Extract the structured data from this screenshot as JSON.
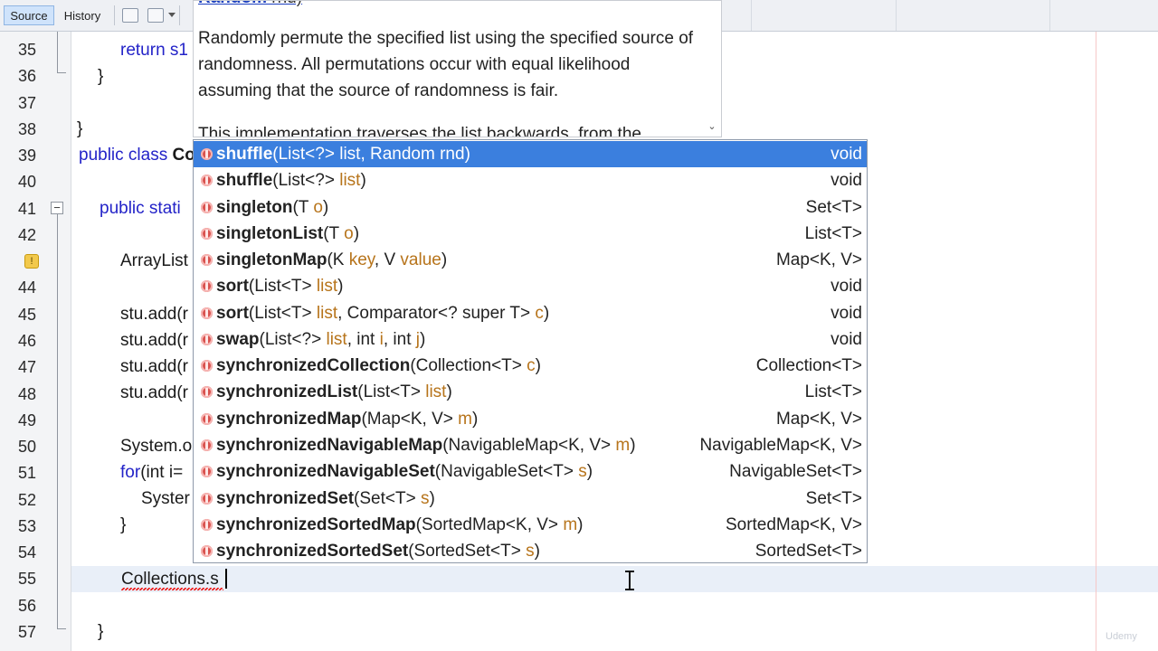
{
  "toolbar": {
    "tabs": [
      {
        "label": "Source",
        "active": true
      },
      {
        "label": "History",
        "active": false
      }
    ],
    "icons": [
      "back-history-icon",
      "forward-history-icon",
      "dropdown-icon"
    ]
  },
  "editor": {
    "line_numbers": [
      "35",
      "36",
      "37",
      "38",
      "39",
      "40",
      "41",
      "42",
      "",
      "44",
      "45",
      "46",
      "47",
      "48",
      "49",
      "50",
      "51",
      "52",
      "53",
      "54",
      "55",
      "56",
      "57"
    ],
    "code": {
      "l35": "return s1",
      "l36": "}",
      "l38": "}",
      "l39_kw": "public class ",
      "l39_name": "Co",
      "l41_kw": "public stati",
      "l43": "ArrayList",
      "l45": "stu.add(r",
      "l46": "stu.add(r",
      "l47": "stu.add(r",
      "l48": "stu.add(r",
      "l50": "System.o",
      "l51_kw": "for",
      "l51_rest": "(int i=",
      "l52": "Syster",
      "l53": "}",
      "l55": "Collections.s",
      "l57": "}"
    },
    "accent": "#3b7fde",
    "keyword_color": "#2323c8"
  },
  "javadoc": {
    "signature_name": "Random",
    "signature_rest": " rnd)",
    "body": "Randomly permute the specified list using the specified source of randomness. All permutations occur with equal likelihood assuming that the source of randomness is fair.",
    "more": "This implementation traverses the list backwards, from the"
  },
  "completion": {
    "items": [
      {
        "name": "shuffle",
        "pre": "(List<?> ",
        "params": [
          {
            "t": "",
            "n": "list"
          },
          {
            "t": ", Random ",
            "n": "rnd"
          }
        ],
        "post": ")",
        "ret": "void",
        "selected": true
      },
      {
        "name": "shuffle",
        "pre": "(List<?> ",
        "params": [
          {
            "t": "",
            "n": "list"
          }
        ],
        "post": ")",
        "ret": "void"
      },
      {
        "name": "singleton",
        "pre": "(T ",
        "params": [
          {
            "t": "",
            "n": "o"
          }
        ],
        "post": ")",
        "ret": "Set<T>"
      },
      {
        "name": "singletonList",
        "pre": "(T ",
        "params": [
          {
            "t": "",
            "n": "o"
          }
        ],
        "post": ")",
        "ret": "List<T>"
      },
      {
        "name": "singletonMap",
        "pre": "(K ",
        "params": [
          {
            "t": "",
            "n": "key"
          },
          {
            "t": ", V ",
            "n": "value"
          }
        ],
        "post": ")",
        "ret": "Map<K, V>"
      },
      {
        "name": "sort",
        "pre": "(List<T> ",
        "params": [
          {
            "t": "",
            "n": "list"
          }
        ],
        "post": ")",
        "ret": "void"
      },
      {
        "name": "sort",
        "pre": "(List<T> ",
        "params": [
          {
            "t": "",
            "n": "list"
          },
          {
            "t": ", Comparator<? super T> ",
            "n": "c"
          }
        ],
        "post": ")",
        "ret": "void"
      },
      {
        "name": "swap",
        "pre": "(List<?> ",
        "params": [
          {
            "t": "",
            "n": "list"
          },
          {
            "t": ", int ",
            "n": "i"
          },
          {
            "t": ", int ",
            "n": "j"
          }
        ],
        "post": ")",
        "ret": "void"
      },
      {
        "name": "synchronizedCollection",
        "pre": "(Collection<T> ",
        "params": [
          {
            "t": "",
            "n": "c"
          }
        ],
        "post": ")",
        "ret": "Collection<T>"
      },
      {
        "name": "synchronizedList",
        "pre": "(List<T> ",
        "params": [
          {
            "t": "",
            "n": "list"
          }
        ],
        "post": ")",
        "ret": "List<T>"
      },
      {
        "name": "synchronizedMap",
        "pre": "(Map<K, V> ",
        "params": [
          {
            "t": "",
            "n": "m"
          }
        ],
        "post": ")",
        "ret": "Map<K, V>"
      },
      {
        "name": "synchronizedNavigableMap",
        "pre": "(NavigableMap<K, V> ",
        "params": [
          {
            "t": "",
            "n": "m"
          }
        ],
        "post": ")",
        "ret": "NavigableMap<K, V>"
      },
      {
        "name": "synchronizedNavigableSet",
        "pre": "(NavigableSet<T> ",
        "params": [
          {
            "t": "",
            "n": "s"
          }
        ],
        "post": ")",
        "ret": "NavigableSet<T>"
      },
      {
        "name": "synchronizedSet",
        "pre": "(Set<T> ",
        "params": [
          {
            "t": "",
            "n": "s"
          }
        ],
        "post": ")",
        "ret": "Set<T>"
      },
      {
        "name": "synchronizedSortedMap",
        "pre": "(SortedMap<K, V> ",
        "params": [
          {
            "t": "",
            "n": "m"
          }
        ],
        "post": ")",
        "ret": "SortedMap<K, V>"
      },
      {
        "name": "synchronizedSortedSet",
        "pre": "(SortedSet<T> ",
        "params": [
          {
            "t": "",
            "n": "s"
          }
        ],
        "post": ")",
        "ret": "SortedSet<T>"
      }
    ]
  }
}
